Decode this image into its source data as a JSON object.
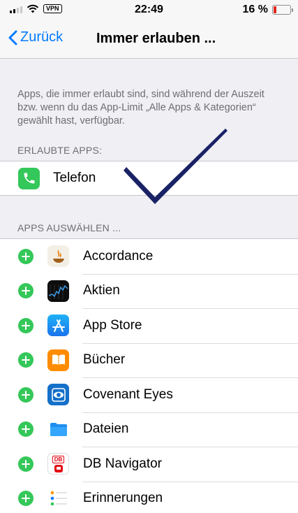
{
  "status_bar": {
    "vpn": "VPN",
    "time": "22:49",
    "battery_text": "16 %",
    "battery_level": 0.16
  },
  "nav": {
    "back_label": "Zurück",
    "title": "Immer erlauben ..."
  },
  "info_text": "Apps, die immer erlaubt sind, sind während der Auszeit bzw. wenn du das App-Limit „Alle Apps & Kategorien“ gewählt hast, verfügbar.",
  "allowed_section": {
    "header": "ERLAUBTE APPS:",
    "apps": [
      {
        "label": "Telefon",
        "icon": "phone-icon"
      }
    ]
  },
  "choose_section": {
    "header": "APPS AUSWÄHLEN ...",
    "apps": [
      {
        "label": "Accordance",
        "icon": "accordance-icon"
      },
      {
        "label": "Aktien",
        "icon": "stocks-icon"
      },
      {
        "label": "App Store",
        "icon": "app-store-icon"
      },
      {
        "label": "Bücher",
        "icon": "books-icon"
      },
      {
        "label": "Covenant Eyes",
        "icon": "covenant-eyes-icon"
      },
      {
        "label": "Dateien",
        "icon": "files-icon"
      },
      {
        "label": "DB Navigator",
        "icon": "db-navigator-icon",
        "badge": "DB"
      },
      {
        "label": "Erinnerungen",
        "icon": "reminders-icon"
      }
    ]
  },
  "colors": {
    "accent": "#007aff",
    "add_green": "#34c759",
    "checkmark": "#1a2266"
  }
}
